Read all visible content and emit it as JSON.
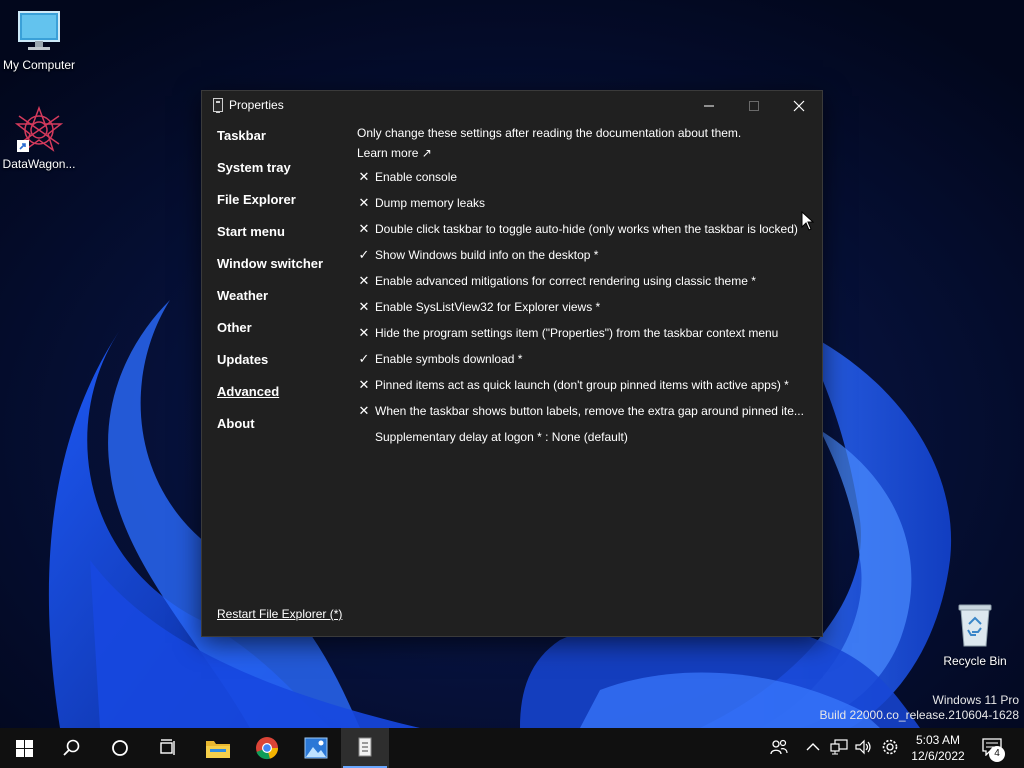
{
  "desktop": {
    "icons": [
      {
        "label": "My Computer",
        "icon": "monitor-icon"
      },
      {
        "label": "DataWagon...",
        "icon": "datawagon-icon"
      },
      {
        "label": "Recycle Bin",
        "icon": "recycle-bin-icon"
      }
    ],
    "watermark": {
      "line1": "Windows 11 Pro",
      "line2": "Build 22000.co_release.210604-1628"
    }
  },
  "window": {
    "title": "Properties",
    "sidebar": [
      {
        "label": "Taskbar"
      },
      {
        "label": "System tray"
      },
      {
        "label": "File Explorer"
      },
      {
        "label": "Start menu"
      },
      {
        "label": "Window switcher"
      },
      {
        "label": "Weather"
      },
      {
        "label": "Other"
      },
      {
        "label": "Updates"
      },
      {
        "label": "Advanced",
        "active": true
      },
      {
        "label": "About"
      }
    ],
    "intro": "Only change these settings after reading the documentation about them.",
    "learn_more": "Learn more ↗",
    "settings": [
      {
        "mark": "✕",
        "checked": false,
        "label": "Enable console"
      },
      {
        "mark": "✕",
        "checked": false,
        "label": "Dump memory leaks"
      },
      {
        "mark": "✕",
        "checked": false,
        "label": "Double click taskbar to toggle auto-hide (only works when the taskbar is locked)"
      },
      {
        "mark": "✓",
        "checked": true,
        "label": "Show Windows build info on the desktop *"
      },
      {
        "mark": "✕",
        "checked": false,
        "label": "Enable advanced mitigations for correct rendering using classic theme *"
      },
      {
        "mark": "✕",
        "checked": false,
        "label": "Enable SysListView32 for Explorer views *"
      },
      {
        "mark": "✕",
        "checked": false,
        "label": "Hide the program settings item (\"Properties\") from the taskbar context menu"
      },
      {
        "mark": "✓",
        "checked": true,
        "label": "Enable symbols download *"
      },
      {
        "mark": "✕",
        "checked": false,
        "label": "Pinned items act as quick launch (don't group pinned items with active apps) *"
      },
      {
        "mark": "✕",
        "checked": false,
        "label": "When the taskbar shows button labels, remove the extra gap around pinned ite..."
      },
      {
        "mark": "",
        "checked": null,
        "label": "Supplementary delay at logon * : None (default)"
      }
    ],
    "restart_link": "Restart File Explorer (*)"
  },
  "taskbar": {
    "buttons": [
      "start-icon",
      "search-icon",
      "cortana-icon",
      "task-view-icon",
      "file-explorer-icon",
      "chrome-icon",
      "photos-icon",
      "properties-app-icon"
    ],
    "clock": {
      "time": "5:03 AM",
      "date": "12/6/2022"
    },
    "notification_count": "4"
  }
}
